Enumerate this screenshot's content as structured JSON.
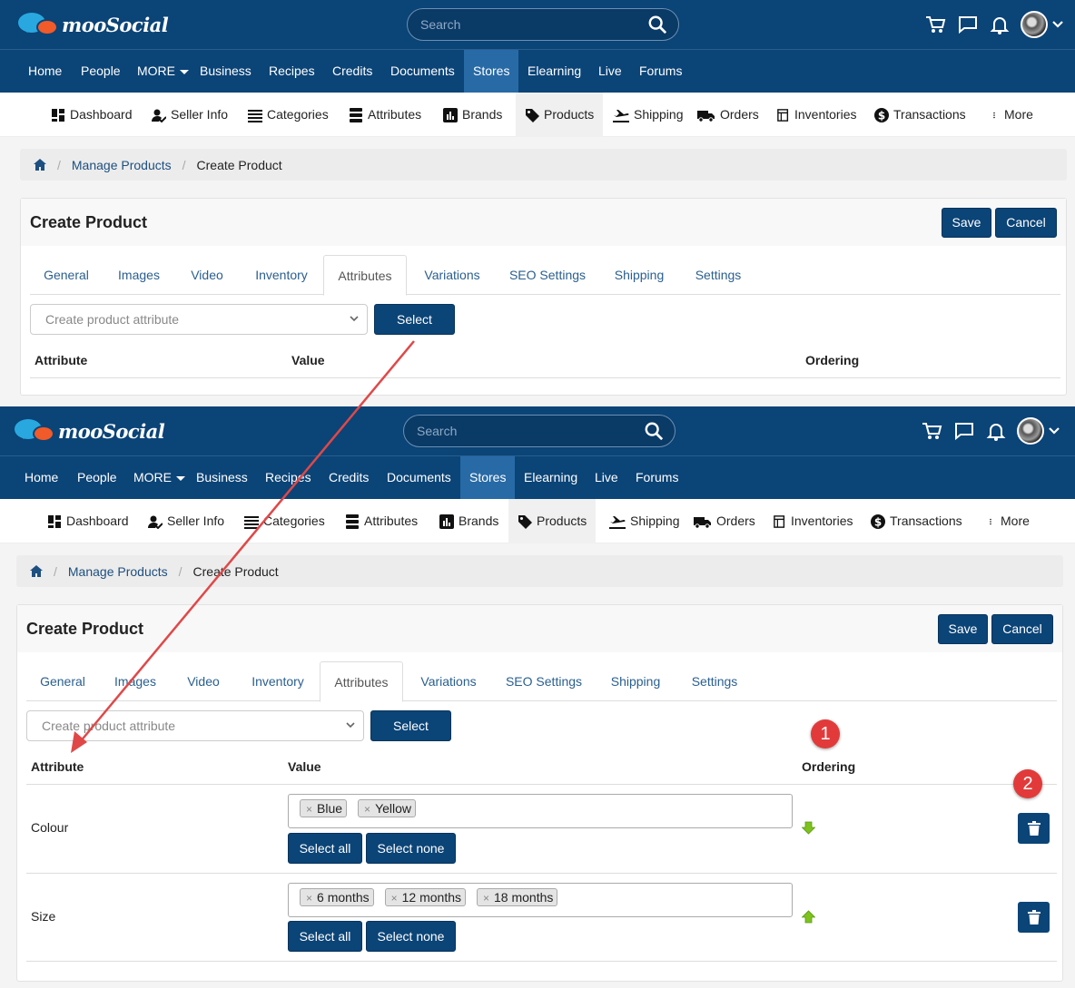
{
  "brand": {
    "name": "mooSocial"
  },
  "search": {
    "placeholder": "Search"
  },
  "main_nav": [
    "Home",
    "People",
    "MORE",
    "Business",
    "Recipes",
    "Credits",
    "Documents",
    "Stores",
    "Elearning",
    "Live",
    "Forums"
  ],
  "active_main_nav": "Stores",
  "sub_nav": [
    {
      "label": "Dashboard",
      "icon": "dashboard-icon"
    },
    {
      "label": "Seller Info",
      "icon": "seller-info-icon"
    },
    {
      "label": "Categories",
      "icon": "list-icon"
    },
    {
      "label": "Attributes",
      "icon": "attributes-icon"
    },
    {
      "label": "Brands",
      "icon": "brands-icon"
    },
    {
      "label": "Products",
      "icon": "tag-icon"
    },
    {
      "label": "Shipping",
      "icon": "plane-icon"
    },
    {
      "label": "Orders",
      "icon": "truck-icon"
    },
    {
      "label": "Inventories",
      "icon": "inventory-icon"
    },
    {
      "label": "Transactions",
      "icon": "dollar-icon"
    },
    {
      "label": "More",
      "icon": "more-vertical-icon"
    }
  ],
  "active_sub_nav": "Products",
  "breadcrumb": {
    "items": [
      "Manage Products",
      "Create Product"
    ]
  },
  "page": {
    "title": "Create Product",
    "save_label": "Save",
    "cancel_label": "Cancel",
    "tabs": [
      "General",
      "Images",
      "Video",
      "Inventory",
      "Attributes",
      "Variations",
      "SEO Settings",
      "Shipping",
      "Settings"
    ],
    "active_tab": "Attributes",
    "attribute_select_placeholder": "Create product attribute",
    "select_button": "Select",
    "columns": {
      "attribute": "Attribute",
      "value": "Value",
      "ordering": "Ordering"
    }
  },
  "attributes": [
    {
      "name": "Colour",
      "values": [
        "Blue",
        "Yellow"
      ],
      "ordering": "down",
      "select_all": "Select all",
      "select_none": "Select none"
    },
    {
      "name": "Size",
      "values": [
        "6 months",
        "12 months",
        "18 months"
      ],
      "ordering": "up",
      "select_all": "Select all",
      "select_none": "Select none"
    }
  ],
  "annotations": [
    "1",
    "2"
  ],
  "colors": {
    "nav": "#0b4477",
    "active_nav": "#276aa6",
    "annotation": "#e23a3a",
    "arrow": "#e04848",
    "ordering_arrow": "#7dc21e"
  }
}
